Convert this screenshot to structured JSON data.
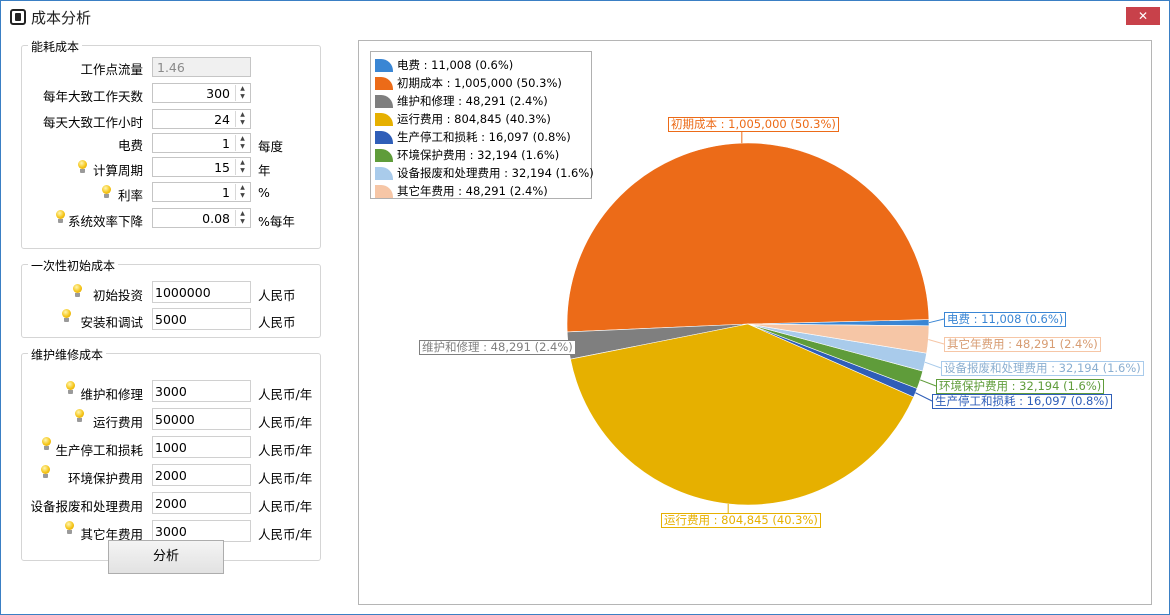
{
  "window": {
    "title": "成本分析",
    "close_label": "✕"
  },
  "energy_group": {
    "title": "能耗成本",
    "flow": {
      "label": "工作点流量",
      "value": "1.46"
    },
    "days": {
      "label": "每年大致工作天数",
      "value": "300"
    },
    "hours": {
      "label": "每天大致工作小时",
      "value": "24"
    },
    "electricity": {
      "label": "电费",
      "value": "1",
      "unit": "每度"
    },
    "period": {
      "label": "计算周期",
      "value": "15",
      "unit": "年"
    },
    "rate": {
      "label": "利率",
      "value": "1",
      "unit": "%"
    },
    "decline": {
      "label": "系统效率下降",
      "value": "0.08",
      "unit": "%每年"
    }
  },
  "initial_group": {
    "title": "一次性初始成本",
    "investment": {
      "label": "初始投资",
      "value": "1000000",
      "unit": "人民币"
    },
    "install": {
      "label": "安装和调试",
      "value": "5000",
      "unit": "人民币"
    }
  },
  "maintenance_group": {
    "title": "维护维修成本",
    "repair": {
      "label": "维护和修理",
      "value": "3000",
      "unit": "人民币/年"
    },
    "operating": {
      "label": "运行费用",
      "value": "50000",
      "unit": "人民币/年"
    },
    "downtime": {
      "label": "生产停工和损耗",
      "value": "1000",
      "unit": "人民币/年"
    },
    "environment": {
      "label": "环境保护费用",
      "value": "2000",
      "unit": "人民币/年"
    },
    "disposal": {
      "label": "设备报废和处理费用",
      "value": "2000",
      "unit": "人民币/年"
    },
    "other": {
      "label": "其它年费用",
      "value": "3000",
      "unit": "人民币/年"
    }
  },
  "analyze_button": "分析",
  "chart_data": {
    "type": "pie",
    "legend_position": "top-left",
    "slices": [
      {
        "name": "电费",
        "value": 11008,
        "label": "电费 : 11,008 (0.6%)",
        "color": "#3a86d4"
      },
      {
        "name": "初期成本",
        "value": 1005000,
        "label": "初期成本 : 1,005,000 (50.3%)",
        "color": "#ec6b18"
      },
      {
        "name": "维护和修理",
        "value": 48291,
        "label": "维护和修理 : 48,291 (2.4%)",
        "color": "#7f7f7f"
      },
      {
        "name": "运行费用",
        "value": 804845,
        "label": "运行费用 : 804,845 (40.3%)",
        "color": "#e6b000"
      },
      {
        "name": "生产停工和损耗",
        "value": 16097,
        "label": "生产停工和损耗 : 16,097 (0.8%)",
        "color": "#2f5eb8"
      },
      {
        "name": "环境保护费用",
        "value": 32194,
        "label": "环境保护费用 : 32,194 (1.6%)",
        "color": "#5f9c3a"
      },
      {
        "name": "设备报废和处理费用",
        "value": 32194,
        "label": "设备报废和处理费用 : 32,194 (1.6%)",
        "color": "#a9cbeb"
      },
      {
        "name": "其它年费用",
        "value": 48291,
        "label": "其它年费用 : 48,291 (2.4%)",
        "color": "#f6c6a6"
      }
    ]
  }
}
